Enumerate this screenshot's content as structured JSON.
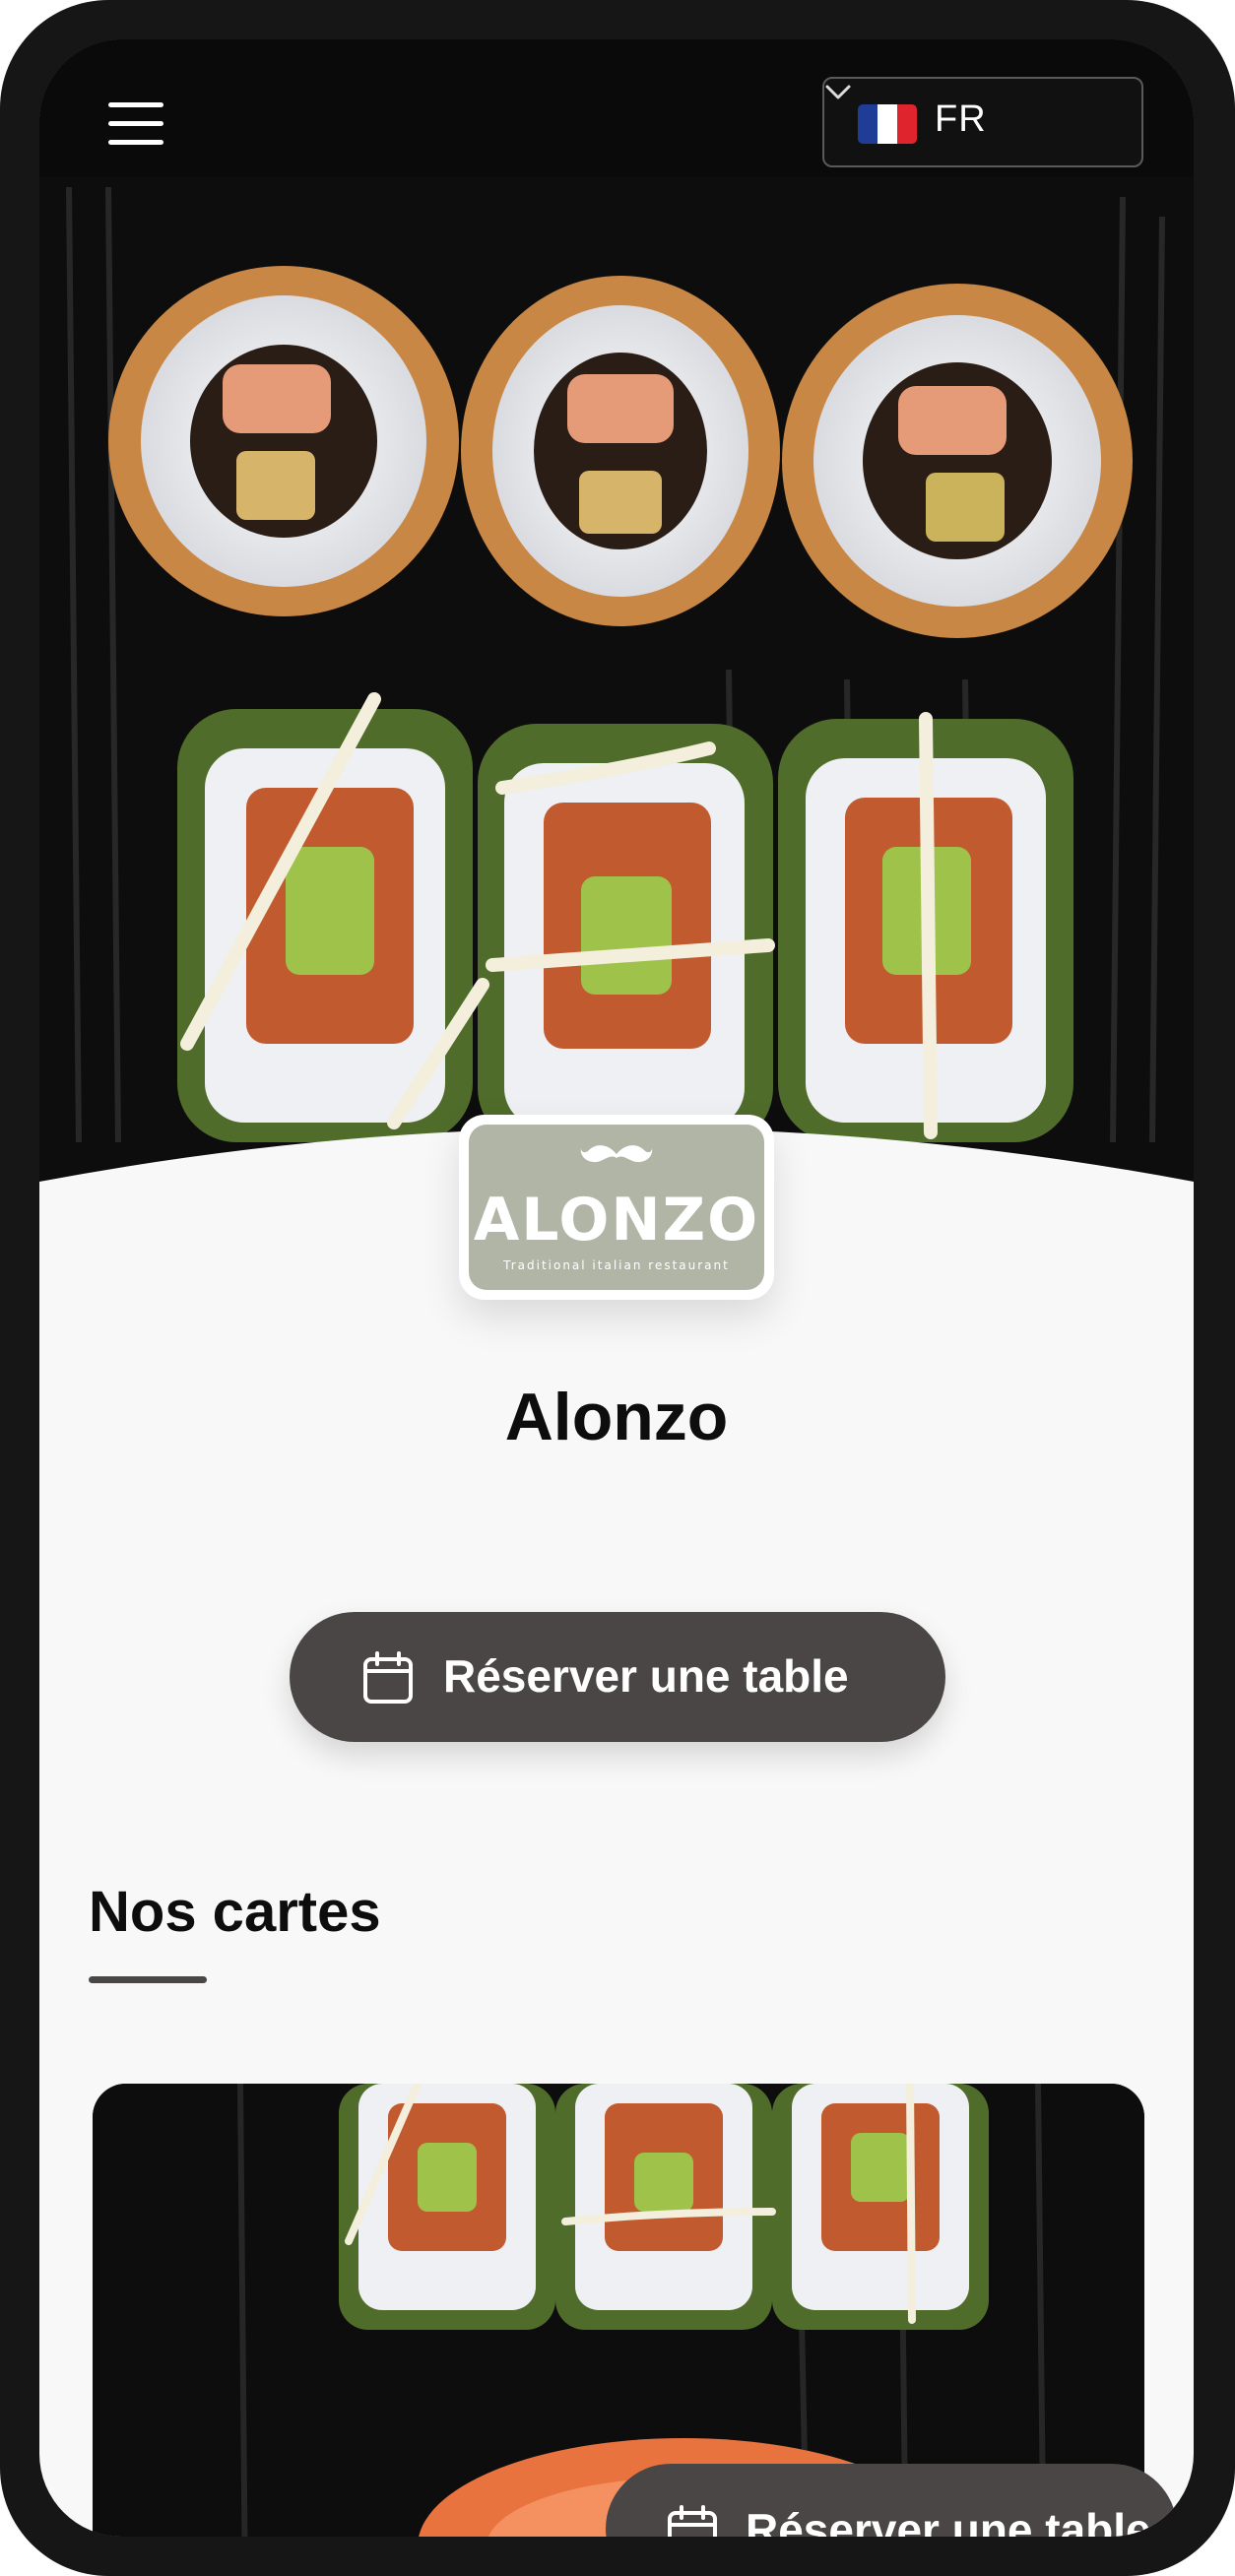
{
  "header": {
    "menu_icon": "hamburger-menu-icon",
    "language": {
      "code": "FR",
      "flag": "france-flag-icon",
      "chevron": "chevron-down-icon"
    }
  },
  "brand": {
    "logo_word": "ALONZO",
    "logo_tagline": "Traditional italian restaurant",
    "logo_bg_color": "#b1b5a6",
    "name": "Alonzo"
  },
  "actions": {
    "reserve_label": "Réserver une table",
    "reserve_icon": "calendar-icon",
    "floating_reserve_label": "Réserver une table"
  },
  "menus_section": {
    "title": "Nos cartes"
  },
  "colors": {
    "button_bg": "#4a4646",
    "page_bg": "#f8f8f8",
    "frame": "#161616"
  }
}
